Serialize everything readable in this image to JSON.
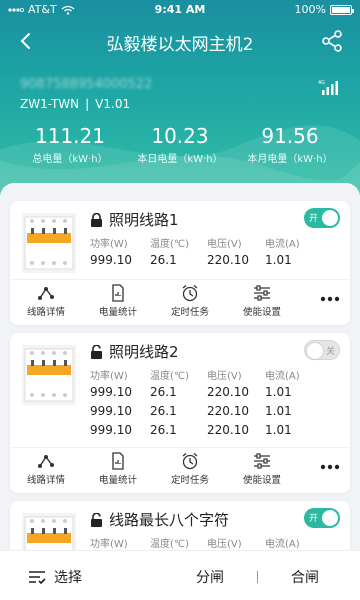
{
  "status_bar": {
    "carrier": "AT&T",
    "time": "9:41 AM",
    "battery": "100%"
  },
  "nav": {
    "title": "弘毅楼以太网主机2"
  },
  "device": {
    "serial": "9087588954000522",
    "model": "ZW1-TWN",
    "version": "V1.01"
  },
  "stats": [
    {
      "value": "111.21",
      "label": "总电量（kW·h）"
    },
    {
      "value": "10.23",
      "label": "本日电量（kW·h）"
    },
    {
      "value": "91.56",
      "label": "本月电量（kW·h）"
    }
  ],
  "metric_headers": [
    "功率(W)",
    "温度(℃)",
    "电压(V)",
    "电流(A)"
  ],
  "actions": [
    "线路详情",
    "电量统计",
    "定时任务",
    "使能设置"
  ],
  "circuits": [
    {
      "name": "照明线路1",
      "locked": true,
      "switch_label": "开",
      "switch_on": true,
      "rows": [
        [
          "999.10",
          "26.1",
          "220.10",
          "1.01"
        ]
      ]
    },
    {
      "name": "照明线路2",
      "locked": false,
      "switch_label": "关",
      "switch_on": false,
      "rows": [
        [
          "999.10",
          "26.1",
          "220.10",
          "1.01"
        ],
        [
          "999.10",
          "26.1",
          "220.10",
          "1.01"
        ],
        [
          "999.10",
          "26.1",
          "220.10",
          "1.01"
        ]
      ]
    },
    {
      "name": "线路最长八个字符",
      "locked": false,
      "switch_label": "开",
      "switch_on": true,
      "rows": []
    }
  ],
  "bottom_bar": {
    "select_label": "选择",
    "split_label": "分闸",
    "close_label": "合闸"
  },
  "colors": {
    "accent": "#2bb9a2",
    "header_top": "#1a8fa0",
    "header_bottom": "#35c0a6",
    "breaker_orange": "#f5a623"
  }
}
